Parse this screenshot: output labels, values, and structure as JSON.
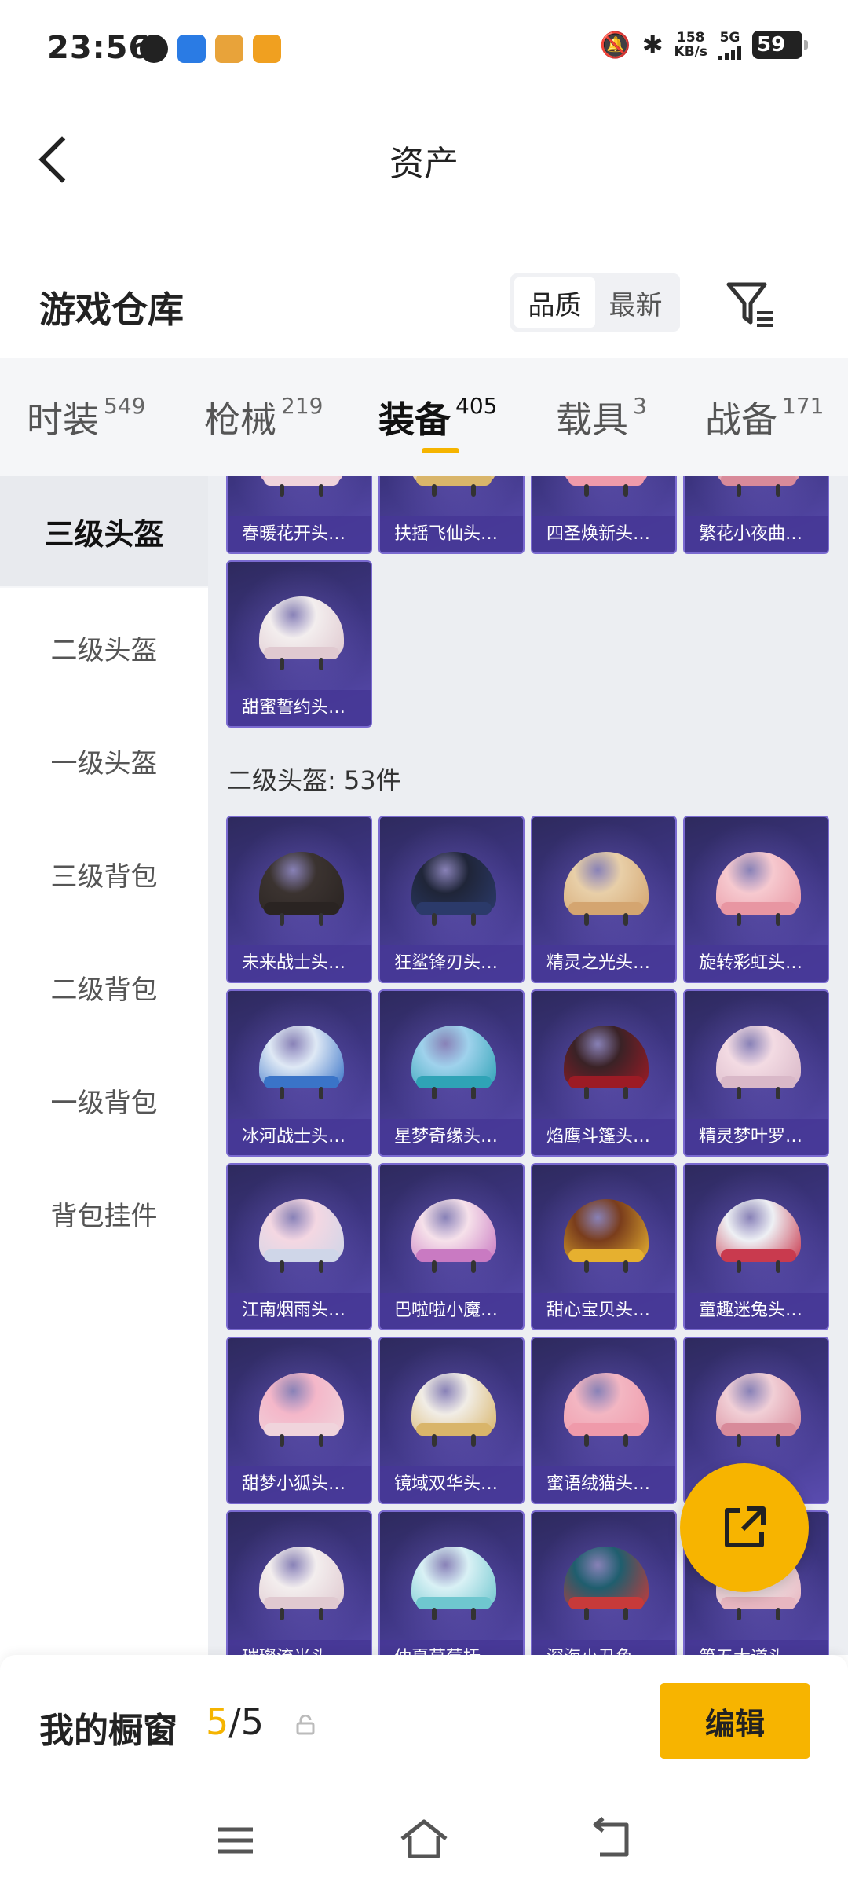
{
  "status_bar": {
    "time": "23:56",
    "net_speed_value": "158",
    "net_speed_unit": "KB/s",
    "network": "5G",
    "battery": "59"
  },
  "header": {
    "title": "资产"
  },
  "warehouse": {
    "title": "游戏仓库",
    "sort_options": [
      "品质",
      "最新"
    ],
    "active_sort": "品质"
  },
  "category_tabs": [
    {
      "label": "时装",
      "count": "549"
    },
    {
      "label": "枪械",
      "count": "219"
    },
    {
      "label": "装备",
      "count": "405",
      "active": true
    },
    {
      "label": "载具",
      "count": "3"
    },
    {
      "label": "战备",
      "count": "171"
    }
  ],
  "sidebar": {
    "items": [
      "三级头盔",
      "二级头盔",
      "一级头盔",
      "三级背包",
      "二级背包",
      "一级背包",
      "背包挂件"
    ],
    "active": "三级头盔"
  },
  "level3_tail": {
    "items": [
      "春暖花开头…",
      "扶摇飞仙头…",
      "四圣焕新头…",
      "繁花小夜曲…",
      "甜蜜誓约头…"
    ]
  },
  "level2_section": {
    "title": "二级头盔: 53件",
    "items": [
      "未来战士头…",
      "狂鲨锋刃头…",
      "精灵之光头…",
      "旋转彩虹头…",
      "冰河战士头…",
      "星梦奇缘头…",
      "焰鹰斗篷头…",
      "精灵梦叶罗…",
      "江南烟雨头…",
      "巴啦啦小魔…",
      "甜心宝贝头…",
      "童趣迷兔头…",
      "甜梦小狐头…",
      "镜域双华头…",
      "蜜语绒猫头…",
      "",
      "璀璨流光头…",
      "仲夏草莓抚…",
      "深海小丑鱼…",
      "第五大道头…"
    ]
  },
  "bottom_bar": {
    "shelf_label": "我的橱窗",
    "shelf_current": "5",
    "shelf_total": "/5",
    "edit_label": "编辑"
  },
  "colors": {
    "accent": "#f7b400",
    "card_bg": "#3c3480"
  },
  "icons": {
    "back": "chevron-left-icon",
    "filter": "filter-icon",
    "share": "share-external-icon",
    "lock": "lock-icon"
  }
}
